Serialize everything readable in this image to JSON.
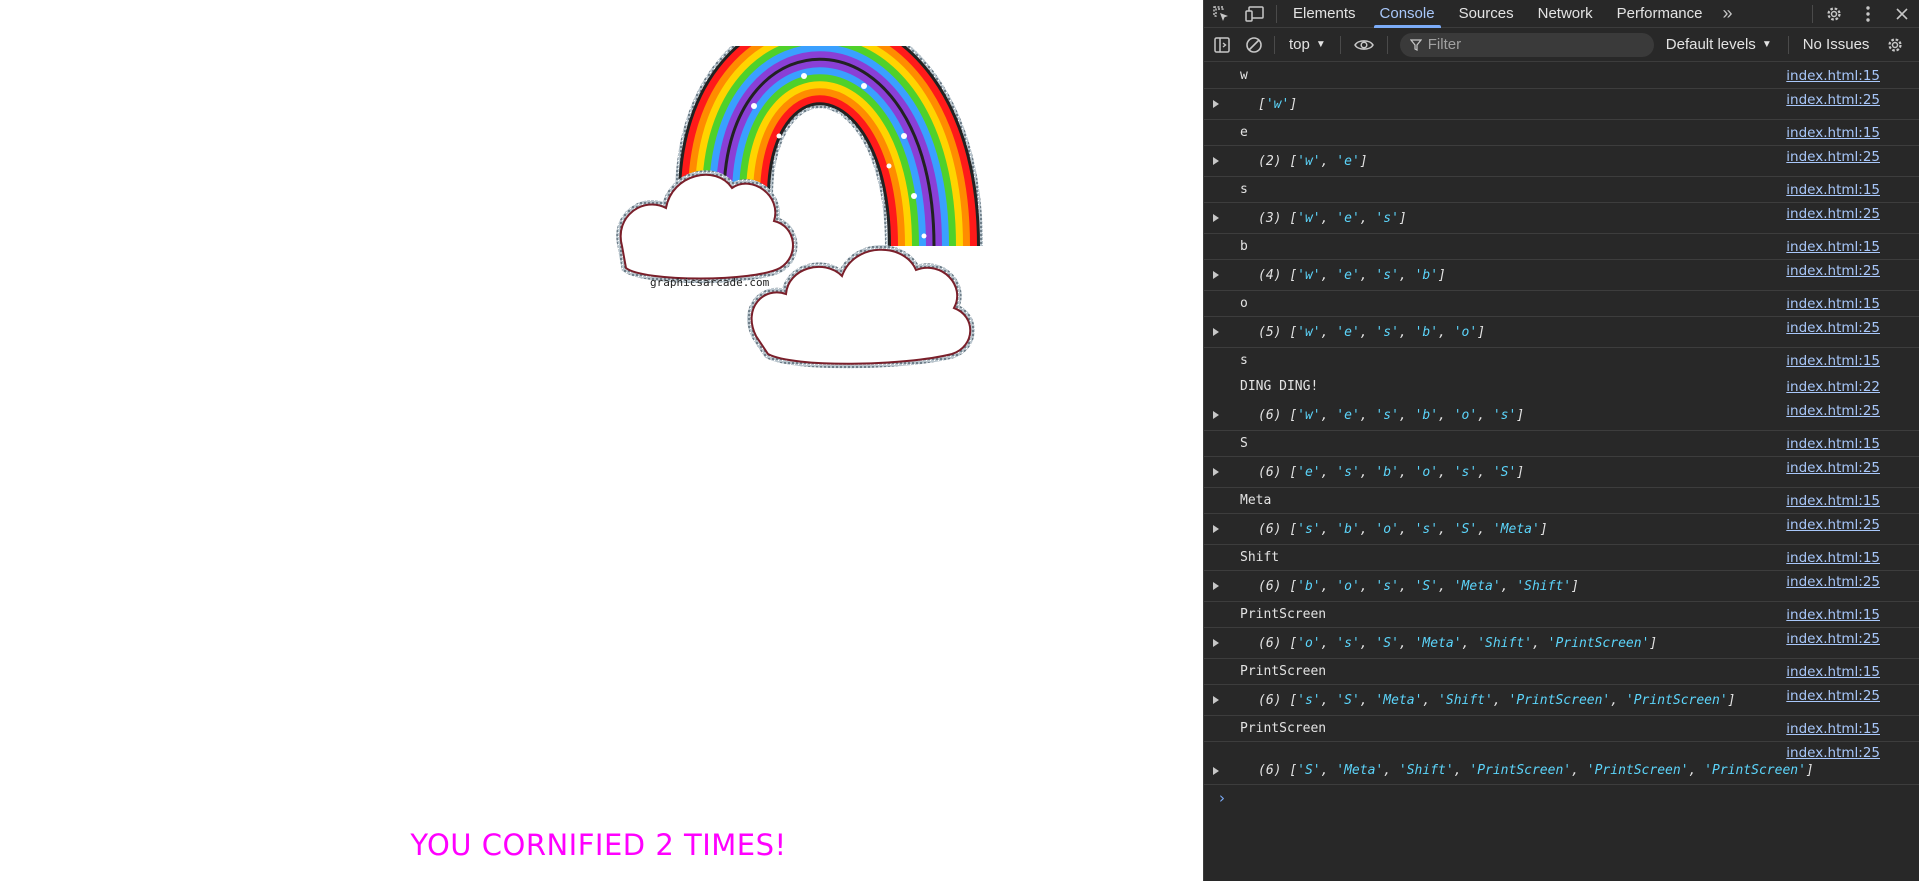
{
  "page": {
    "watermark": "graphicsarcade.com",
    "counter_text": "YOU CORNIFIED 2 TIMES!"
  },
  "devtools": {
    "tabs": [
      {
        "label": "Elements",
        "active": false
      },
      {
        "label": "Console",
        "active": true
      },
      {
        "label": "Sources",
        "active": false
      },
      {
        "label": "Network",
        "active": false
      },
      {
        "label": "Performance",
        "active": false
      }
    ],
    "more_tabs": "»",
    "toolbar": {
      "context": "top",
      "filter_placeholder": "Filter",
      "levels": "Default levels",
      "issues": "No Issues"
    },
    "console": [
      {
        "kind": "log",
        "text": "w",
        "source": "index.html:15"
      },
      {
        "kind": "array",
        "count": "",
        "items": [
          "w"
        ],
        "source": "index.html:25"
      },
      {
        "kind": "log",
        "text": "e",
        "source": "index.html:15"
      },
      {
        "kind": "array",
        "count": "(2)",
        "items": [
          "w",
          "e"
        ],
        "source": "index.html:25"
      },
      {
        "kind": "log",
        "text": "s",
        "source": "index.html:15"
      },
      {
        "kind": "array",
        "count": "(3)",
        "items": [
          "w",
          "e",
          "s"
        ],
        "source": "index.html:25"
      },
      {
        "kind": "log",
        "text": "b",
        "source": "index.html:15"
      },
      {
        "kind": "array",
        "count": "(4)",
        "items": [
          "w",
          "e",
          "s",
          "b"
        ],
        "source": "index.html:25"
      },
      {
        "kind": "log",
        "text": "o",
        "source": "index.html:15"
      },
      {
        "kind": "array",
        "count": "(5)",
        "items": [
          "w",
          "e",
          "s",
          "b",
          "o"
        ],
        "source": "index.html:25"
      },
      {
        "kind": "log",
        "text": "s",
        "source": "index.html:15",
        "no_border": true
      },
      {
        "kind": "log",
        "text": "DING DING!",
        "source": "index.html:22",
        "no_border": true
      },
      {
        "kind": "array",
        "count": "(6)",
        "items": [
          "w",
          "e",
          "s",
          "b",
          "o",
          "s"
        ],
        "source": "index.html:25"
      },
      {
        "kind": "log",
        "text": "S",
        "source": "index.html:15"
      },
      {
        "kind": "array",
        "count": "(6)",
        "items": [
          "e",
          "s",
          "b",
          "o",
          "s",
          "S"
        ],
        "source": "index.html:25"
      },
      {
        "kind": "log",
        "text": "Meta",
        "source": "index.html:15"
      },
      {
        "kind": "array",
        "count": "(6)",
        "items": [
          "s",
          "b",
          "o",
          "s",
          "S",
          "Meta"
        ],
        "source": "index.html:25"
      },
      {
        "kind": "log",
        "text": "Shift",
        "source": "index.html:15"
      },
      {
        "kind": "array",
        "count": "(6)",
        "items": [
          "b",
          "o",
          "s",
          "S",
          "Meta",
          "Shift"
        ],
        "source": "index.html:25"
      },
      {
        "kind": "log",
        "text": "PrintScreen",
        "source": "index.html:15"
      },
      {
        "kind": "array",
        "count": "(6)",
        "items": [
          "o",
          "s",
          "S",
          "Meta",
          "Shift",
          "PrintScreen"
        ],
        "source": "index.html:25"
      },
      {
        "kind": "log",
        "text": "PrintScreen",
        "source": "index.html:15"
      },
      {
        "kind": "array",
        "count": "(6)",
        "items": [
          "s",
          "S",
          "Meta",
          "Shift",
          "PrintScreen",
          "PrintScreen"
        ],
        "source": "index.html:25"
      },
      {
        "kind": "log",
        "text": "PrintScreen",
        "source": "index.html:15"
      },
      {
        "kind": "array",
        "count": "(6)",
        "items": [
          "S",
          "Meta",
          "Shift",
          "PrintScreen",
          "PrintScreen",
          "PrintScreen"
        ],
        "source": "index.html:25",
        "tall": true
      }
    ],
    "prompt": "›"
  }
}
